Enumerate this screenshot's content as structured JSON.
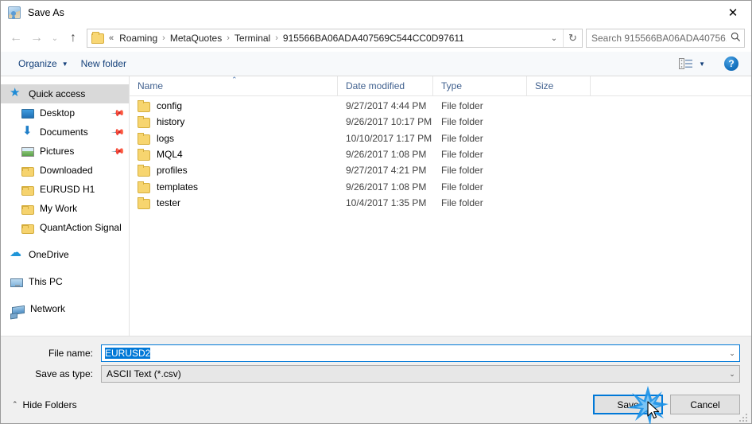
{
  "window": {
    "title": "Save As",
    "app_icon": "save-as-icon",
    "close_label": "✕"
  },
  "nav": {
    "back": "←",
    "forward": "→",
    "recent": "⌄",
    "up": "↑",
    "refresh": "↻",
    "dropdown": "⌄",
    "breadcrumb_prefix": "«",
    "breadcrumbs": [
      {
        "label": "Roaming"
      },
      {
        "label": "MetaQuotes"
      },
      {
        "label": "Terminal"
      },
      {
        "label": "915566BA06ADA407569C544CC0D97611"
      }
    ],
    "separator": "›"
  },
  "search": {
    "placeholder": "Search 915566BA06ADA40756...",
    "icon": "🔍"
  },
  "toolbar": {
    "organize_label": "Organize",
    "organize_caret": "▼",
    "new_folder_label": "New folder",
    "view_caret": "▼",
    "help_label": "?"
  },
  "sidebar": {
    "groups": [
      {
        "items": [
          {
            "label": "Quick access",
            "icon": "star-icon",
            "selected": true,
            "pinned": false,
            "indent": false
          },
          {
            "label": "Desktop",
            "icon": "desktop-icon",
            "selected": false,
            "pinned": true,
            "indent": true
          },
          {
            "label": "Documents",
            "icon": "documents-icon",
            "selected": false,
            "pinned": true,
            "indent": true
          },
          {
            "label": "Pictures",
            "icon": "pictures-icon",
            "selected": false,
            "pinned": true,
            "indent": true
          },
          {
            "label": "Downloaded",
            "icon": "folder-icon",
            "selected": false,
            "pinned": false,
            "indent": true
          },
          {
            "label": "EURUSD H1",
            "icon": "folder-icon",
            "selected": false,
            "pinned": false,
            "indent": true
          },
          {
            "label": "My Work",
            "icon": "folder-icon",
            "selected": false,
            "pinned": false,
            "indent": true
          },
          {
            "label": "QuantAction Signal",
            "icon": "folder-icon",
            "selected": false,
            "pinned": false,
            "indent": true
          }
        ]
      },
      {
        "items": [
          {
            "label": "OneDrive",
            "icon": "cloud-icon",
            "selected": false,
            "pinned": false,
            "indent": false
          }
        ]
      },
      {
        "items": [
          {
            "label": "This PC",
            "icon": "pc-icon",
            "selected": false,
            "pinned": false,
            "indent": false
          }
        ]
      },
      {
        "items": [
          {
            "label": "Network",
            "icon": "network-icon",
            "selected": false,
            "pinned": false,
            "indent": false
          }
        ]
      }
    ],
    "pin_glyph": "📌"
  },
  "filelist": {
    "columns": [
      {
        "label": "Name",
        "sorted": "asc",
        "sort_glyph": "⌃"
      },
      {
        "label": "Date modified",
        "sorted": "",
        "sort_glyph": ""
      },
      {
        "label": "Type",
        "sorted": "",
        "sort_glyph": ""
      },
      {
        "label": "Size",
        "sorted": "",
        "sort_glyph": ""
      }
    ],
    "rows": [
      {
        "name": "config",
        "date": "9/27/2017 4:44 PM",
        "type": "File folder",
        "size": ""
      },
      {
        "name": "history",
        "date": "9/26/2017 10:17 PM",
        "type": "File folder",
        "size": ""
      },
      {
        "name": "logs",
        "date": "10/10/2017 1:17 PM",
        "type": "File folder",
        "size": ""
      },
      {
        "name": "MQL4",
        "date": "9/26/2017 1:08 PM",
        "type": "File folder",
        "size": ""
      },
      {
        "name": "profiles",
        "date": "9/27/2017 4:21 PM",
        "type": "File folder",
        "size": ""
      },
      {
        "name": "templates",
        "date": "9/26/2017 1:08 PM",
        "type": "File folder",
        "size": ""
      },
      {
        "name": "tester",
        "date": "10/4/2017 1:35 PM",
        "type": "File folder",
        "size": ""
      }
    ]
  },
  "form": {
    "filename_label": "File name:",
    "filename_value": "EURUSD2",
    "filetype_label": "Save as type:",
    "filetype_value": "ASCII Text (*.csv)",
    "combo_arrow": "⌄"
  },
  "footer": {
    "hide_folders_label": "Hide Folders",
    "hide_folders_caret": "⌃",
    "save_label": "Save",
    "cancel_label": "Cancel"
  },
  "colors": {
    "accent": "#0078d7",
    "selection": "#0078d7",
    "sidebar_selected": "#d9d9d9",
    "column_header_text": "#41618f",
    "toolbar_text": "#14407a",
    "folder": "#f7d56f"
  }
}
